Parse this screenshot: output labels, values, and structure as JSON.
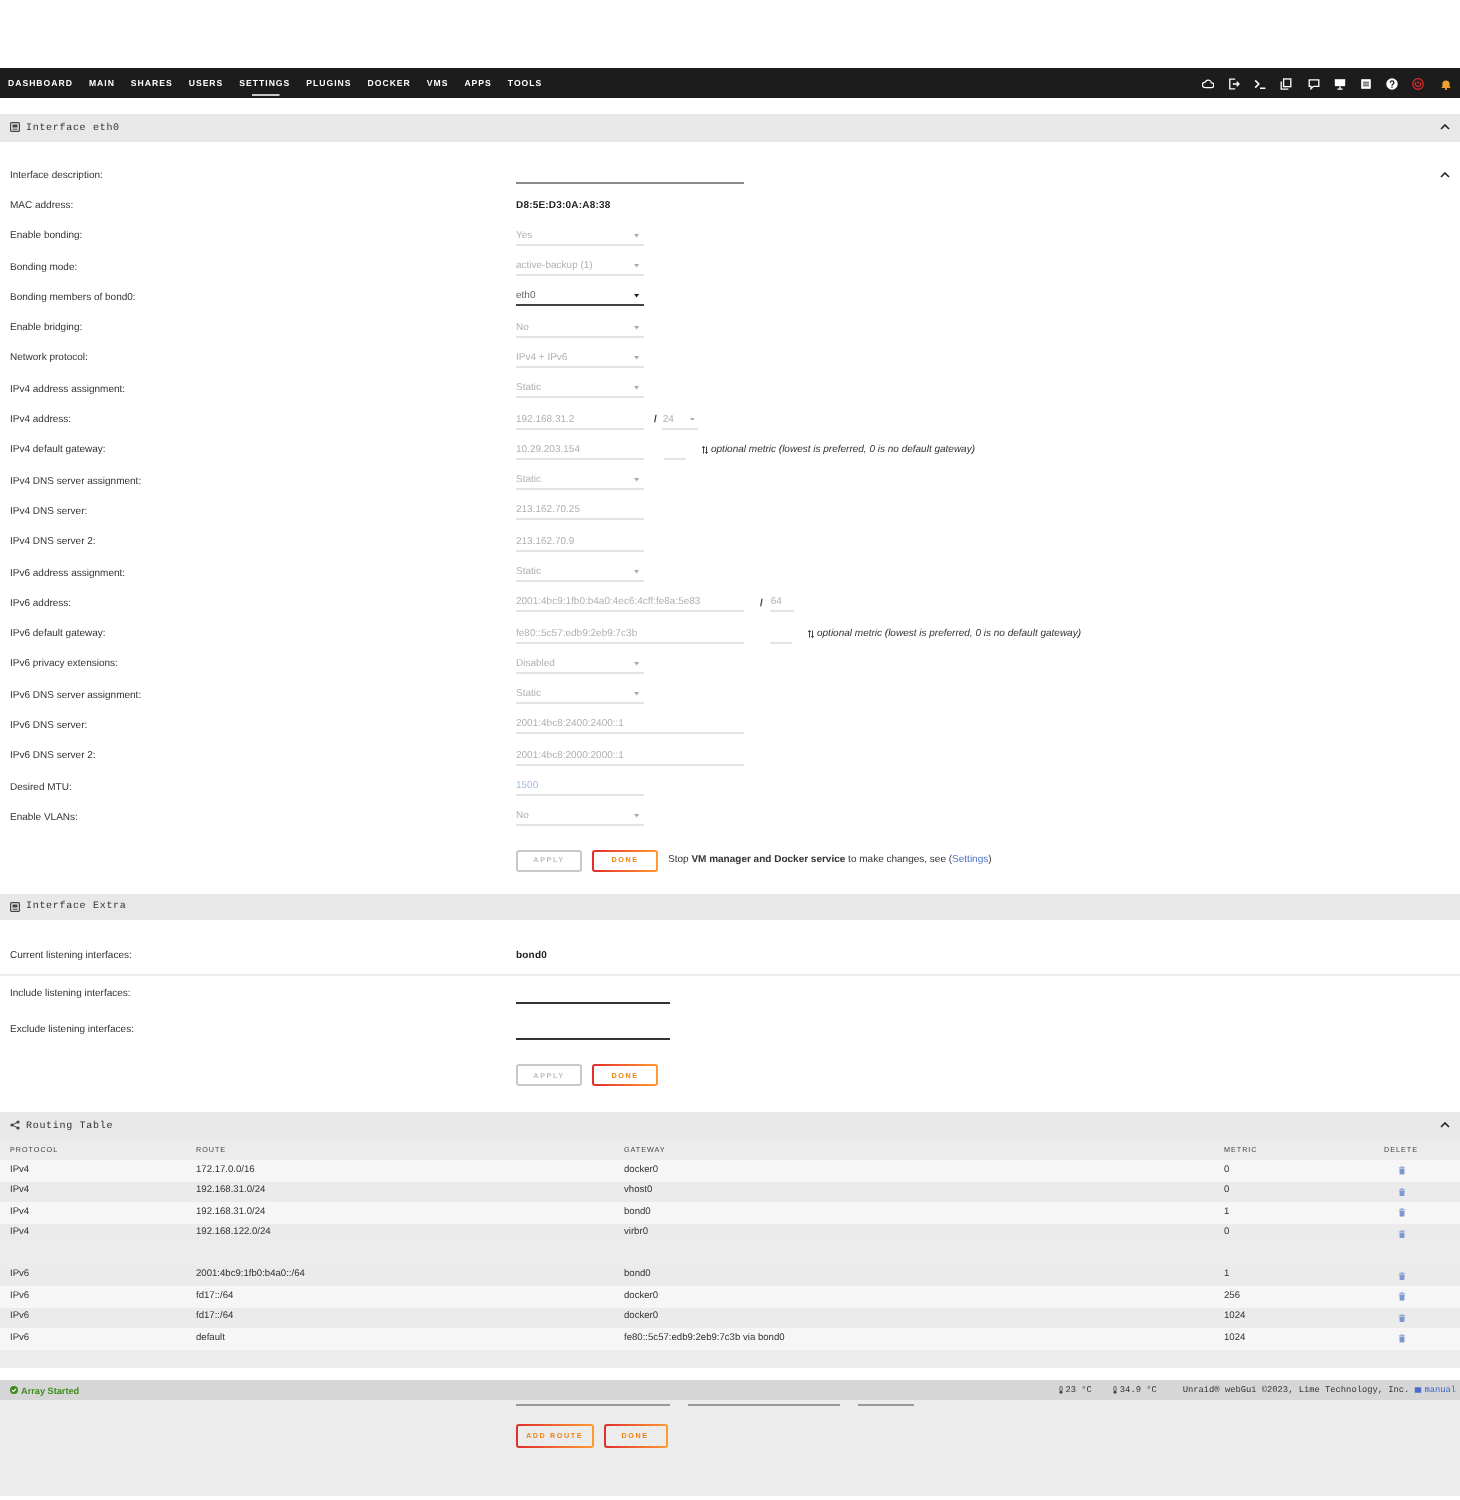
{
  "nav": {
    "items": [
      {
        "label": "DASHBOARD",
        "selected": false
      },
      {
        "label": "MAIN",
        "selected": false
      },
      {
        "label": "SHARES",
        "selected": false
      },
      {
        "label": "USERS",
        "selected": false
      },
      {
        "label": "SETTINGS",
        "selected": true
      },
      {
        "label": "PLUGINS",
        "selected": false
      },
      {
        "label": "DOCKER",
        "selected": false
      },
      {
        "label": "VMS",
        "selected": false
      },
      {
        "label": "APPS",
        "selected": false
      },
      {
        "label": "TOOLS",
        "selected": false
      }
    ]
  },
  "interface_eth0": {
    "title": "Interface eth0",
    "expanded": true,
    "fields": [
      {
        "label": "Interface description:",
        "kind": "long_input",
        "disabled": false,
        "expanded": true
      },
      {
        "label": "MAC address:",
        "kind": "text",
        "value": "D8:5E:D3:0A:A8:38"
      },
      {
        "label": "Enable bonding:",
        "kind": "select",
        "value": "Yes",
        "disabled": true
      },
      {
        "label": "Bonding mode:",
        "kind": "select",
        "value": "active-backup (1)",
        "disabled": true
      },
      {
        "label": "Bonding members of bond0:",
        "kind": "select",
        "value": "eth0",
        "disabled": false
      },
      {
        "label": "Enable bridging:",
        "kind": "select",
        "value": "No",
        "disabled": true
      },
      {
        "label": "Network protocol:",
        "kind": "select",
        "value": "IPv4 + IPv6",
        "disabled": true
      },
      {
        "label": "IPv4 address assignment:",
        "kind": "select",
        "value": "Static",
        "disabled": true
      },
      {
        "label": "IPv4 address:",
        "kind": "input",
        "value": "192.168.31.2",
        "disabled": true,
        "prefix_length": {
          "separator": "/",
          "kind": "select",
          "value": "24",
          "disabled": true
        }
      },
      {
        "label": "IPv4 default gateway:",
        "kind": "input",
        "value": "10.29.203.154",
        "disabled": true,
        "metric": {
          "disabled": true
        },
        "note": "optional metric (lowest is preferred, 0 is no default gateway)"
      },
      {
        "label": "IPv4 DNS server assignment:",
        "kind": "select",
        "value": "Static",
        "disabled": true
      },
      {
        "label": "IPv4 DNS server:",
        "kind": "input",
        "value": "213.162.70.25",
        "disabled": true
      },
      {
        "label": "IPv4 DNS server 2:",
        "kind": "input",
        "value": "213.162.70.9",
        "disabled": true
      },
      {
        "label": "IPv6 address assignment:",
        "kind": "select",
        "value": "Static",
        "disabled": true
      },
      {
        "label": "IPv6 address:",
        "kind": "long_input",
        "value": "2001:4bc9:1fb0:b4a0:4ec6:4cff:fe8a:5e83",
        "disabled": true,
        "prefix_length": {
          "separator": "/",
          "kind": "input",
          "value": "64",
          "disabled": true
        }
      },
      {
        "label": "IPv6 default gateway:",
        "kind": "long_input",
        "value": "fe80::5c57:edb9:2eb9:7c3b",
        "disabled": true,
        "metric": {
          "disabled": true
        },
        "note": "optional metric (lowest is preferred, 0 is no default gateway)"
      },
      {
        "label": "IPv6 privacy extensions:",
        "kind": "select",
        "value": "Disabled",
        "disabled": true
      },
      {
        "label": "IPv6 DNS server assignment:",
        "kind": "select",
        "value": "Static",
        "disabled": true
      },
      {
        "label": "IPv6 DNS server:",
        "kind": "long_input",
        "value": "2001:4bc8:2400:2400::1",
        "disabled": true
      },
      {
        "label": "IPv6 DNS server 2:",
        "kind": "long_input",
        "value": "2001:4bc8:2000:2000::1",
        "disabled": true
      },
      {
        "label": "Desired MTU:",
        "kind": "input",
        "placeholder": "1500",
        "disabled": true
      },
      {
        "label": "Enable VLANs:",
        "kind": "select",
        "value": "No",
        "disabled": true
      }
    ],
    "buttons": [
      {
        "label": "APPLY",
        "disabled": true
      },
      {
        "label": "DONE",
        "disabled": false
      }
    ],
    "notice": {
      "text": "Stop **VM manager and Docker service** to make changes, see (",
      "link": "Settings",
      "after": ")"
    }
  },
  "interface_extra": {
    "title": "Interface Extra",
    "fields": [
      {
        "label": "Current listening interfaces:",
        "kind": "text",
        "value": "bond0"
      },
      {
        "label": "Include listening interfaces:",
        "kind": "input",
        "disabled": false
      },
      {
        "label": "Exclude listening interfaces:",
        "kind": "input",
        "disabled": false
      }
    ],
    "buttons": [
      {
        "label": "APPLY",
        "disabled": true
      },
      {
        "label": "DONE",
        "disabled": false
      }
    ]
  },
  "routing_table": {
    "title": "Routing Table",
    "expanded": true,
    "columns": [
      "PROTOCOL",
      "ROUTE",
      "GATEWAY",
      "METRIC",
      "DELETE"
    ],
    "row_groups": [
      [
        {
          "protocol": "IPv4",
          "route": "172.17.0.0/16",
          "gateway": "docker0",
          "metric": "0"
        },
        {
          "protocol": "IPv4",
          "route": "192.168.31.0/24",
          "gateway": "vhost0",
          "metric": "0"
        },
        {
          "protocol": "IPv4",
          "route": "192.168.31.0/24",
          "gateway": "bond0",
          "metric": "1"
        },
        {
          "protocol": "IPv4",
          "route": "192.168.122.0/24",
          "gateway": "virbr0",
          "metric": "0"
        }
      ],
      [
        {
          "protocol": "IPv6",
          "route": "2001:4bc9:1fb0:b4a0::/64",
          "gateway": "bond0",
          "metric": "1"
        },
        {
          "protocol": "IPv6",
          "route": "fd17::/64",
          "gateway": "docker0",
          "metric": "256"
        },
        {
          "protocol": "IPv6",
          "route": "fd17::/64",
          "gateway": "docker0",
          "metric": "1024"
        },
        {
          "protocol": "IPv6",
          "route": "default",
          "gateway": "fe80::5c57:edb9:2eb9:7c3b via bond0",
          "metric": "1024"
        }
      ]
    ],
    "add_route": {
      "fields": [
        {
          "disabled": false
        },
        {
          "disabled": false
        },
        {
          "disabled": false
        }
      ],
      "buttons": [
        {
          "label": "ADD ROUTE",
          "disabled": false
        },
        {
          "label": "DONE",
          "disabled": false
        }
      ]
    }
  },
  "status_bar": {
    "status": "Array Started",
    "temperatures": [
      "23 °C",
      "34.9 °C"
    ],
    "copyright": "Unraid® webGui ©2023, Lime Technology, Inc.",
    "manual_link": "manual"
  }
}
